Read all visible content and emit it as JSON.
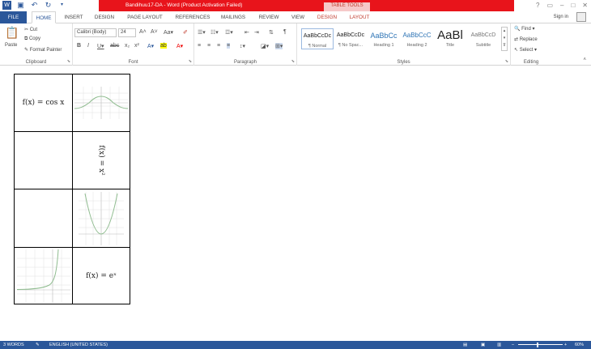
{
  "titlebar": {
    "doc_title": "Bandihuu17-DA - Word (Product Activation Failed)",
    "contextual_label": "TABLE TOOLS",
    "qat_icons": [
      "word-icon",
      "save-icon",
      "undo-icon",
      "redo-icon",
      "customize-icon"
    ],
    "help": "?",
    "minimize": "–",
    "close": "✕"
  },
  "tabs": {
    "file": "FILE",
    "home": "HOME",
    "insert": "INSERT",
    "design": "DESIGN",
    "page_layout": "PAGE LAYOUT",
    "references": "REFERENCES",
    "mailings": "MAILINGS",
    "review": "REVIEW",
    "view": "VIEW",
    "tt_design": "DESIGN",
    "tt_layout": "LAYOUT",
    "sign_in": "Sign in"
  },
  "clipboard": {
    "cut": "Cut",
    "copy": "Copy",
    "paste": "Paste",
    "format_painter": "Format Painter",
    "label": "Clipboard"
  },
  "font": {
    "name": "Calibri (Body)",
    "size": "24",
    "label": "Font"
  },
  "paragraph": {
    "label": "Paragraph"
  },
  "styles": {
    "items": [
      {
        "preview": "AaBbCcDc",
        "name": "¶ Normal"
      },
      {
        "preview": "AaBbCcDc",
        "name": "¶ No Spac..."
      },
      {
        "preview": "AaBbCc",
        "name": "Heading 1"
      },
      {
        "preview": "AaBbCcC",
        "name": "Heading 2"
      },
      {
        "preview": "AaBl",
        "name": "Title"
      },
      {
        "preview": "AaBbCcD",
        "name": "Subtitle"
      }
    ],
    "label": "Styles"
  },
  "editing": {
    "find": "Find",
    "replace": "Replace",
    "select": "Select",
    "label": "Editing"
  },
  "document": {
    "cell_cos": "f(x) = cos x",
    "cell_x2": "f(x) = x²",
    "cell_exp": "f(x) = eˣ"
  },
  "statusbar": {
    "words": "3 WORDS",
    "language": "ENGLISH (UNITED STATES)",
    "zoom": "60%"
  },
  "colors": {
    "accent": "#2b579a",
    "red_bar": "#e8141b",
    "contextual": "#c0392b"
  }
}
